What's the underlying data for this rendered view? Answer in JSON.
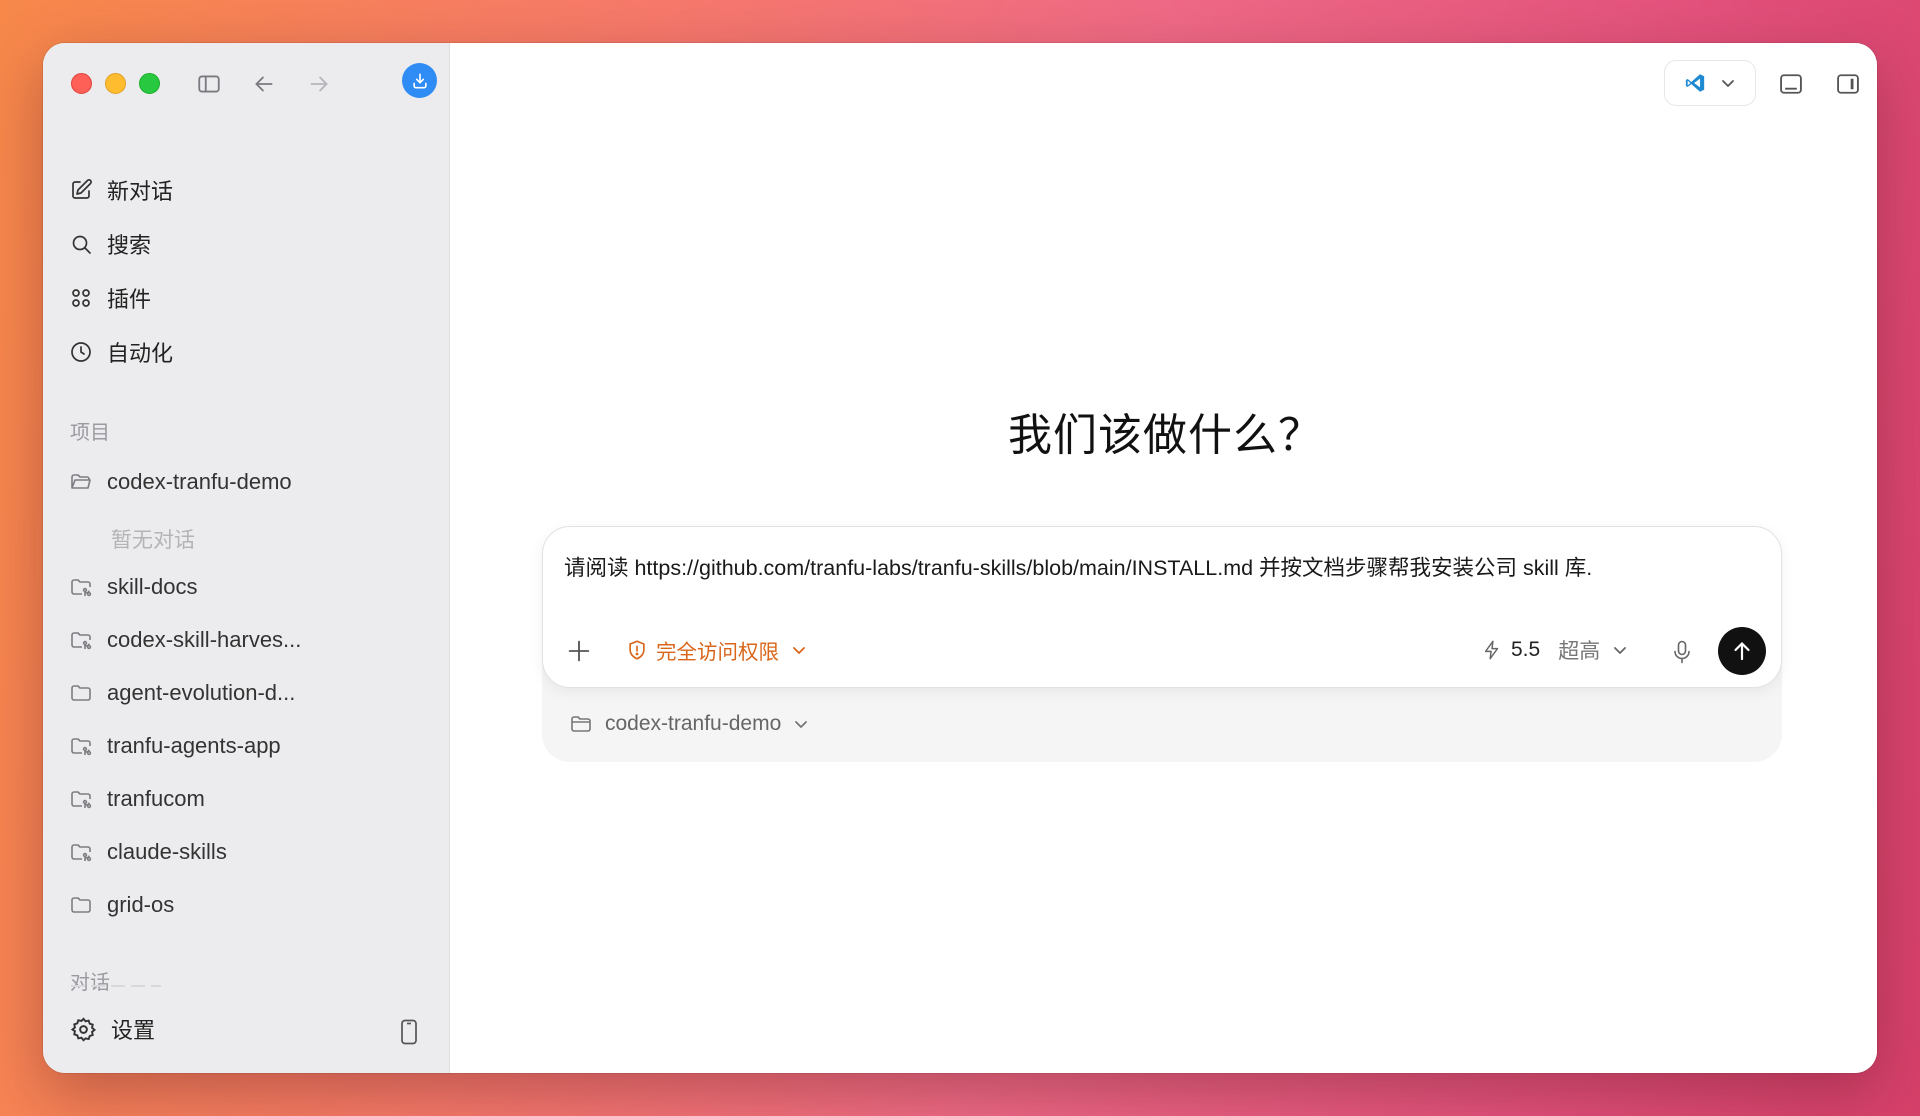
{
  "sidebar": {
    "nav": [
      {
        "label": "新对话",
        "icon": "edit-icon"
      },
      {
        "label": "搜索",
        "icon": "search-icon"
      },
      {
        "label": "插件",
        "icon": "plugins-icon"
      },
      {
        "label": "自动化",
        "icon": "clock-icon"
      }
    ],
    "projects_label": "项目",
    "projects": [
      {
        "label": "codex-tranfu-demo",
        "icon": "folder-open-icon"
      },
      {
        "label": "skill-docs",
        "icon": "folder-git-icon"
      },
      {
        "label": "codex-skill-harves...",
        "icon": "folder-git-icon"
      },
      {
        "label": "agent-evolution-d...",
        "icon": "folder-icon"
      },
      {
        "label": "tranfu-agents-app",
        "icon": "folder-git-icon"
      },
      {
        "label": "tranfucom",
        "icon": "folder-git-icon"
      },
      {
        "label": "claude-skills",
        "icon": "folder-git-icon"
      },
      {
        "label": "grid-os",
        "icon": "folder-icon"
      }
    ],
    "empty_note": "暂无对话",
    "conversations_label": "对话",
    "settings_label": "设置"
  },
  "main": {
    "heading": "我们该做什么？",
    "composer": {
      "text": "请阅读 https://github.com/tranfu-labs/tranfu-skills/blob/main/INSTALL.md 并按文档步骤帮我安装公司 skill 库.",
      "permission_label": "完全访问权限",
      "model_version": "5.5",
      "model_quality": "超高",
      "project": "codex-tranfu-demo"
    }
  },
  "colors": {
    "accent_blue": "#2f8cf4",
    "permission_orange": "#d9661a",
    "send_button": "#111111"
  }
}
